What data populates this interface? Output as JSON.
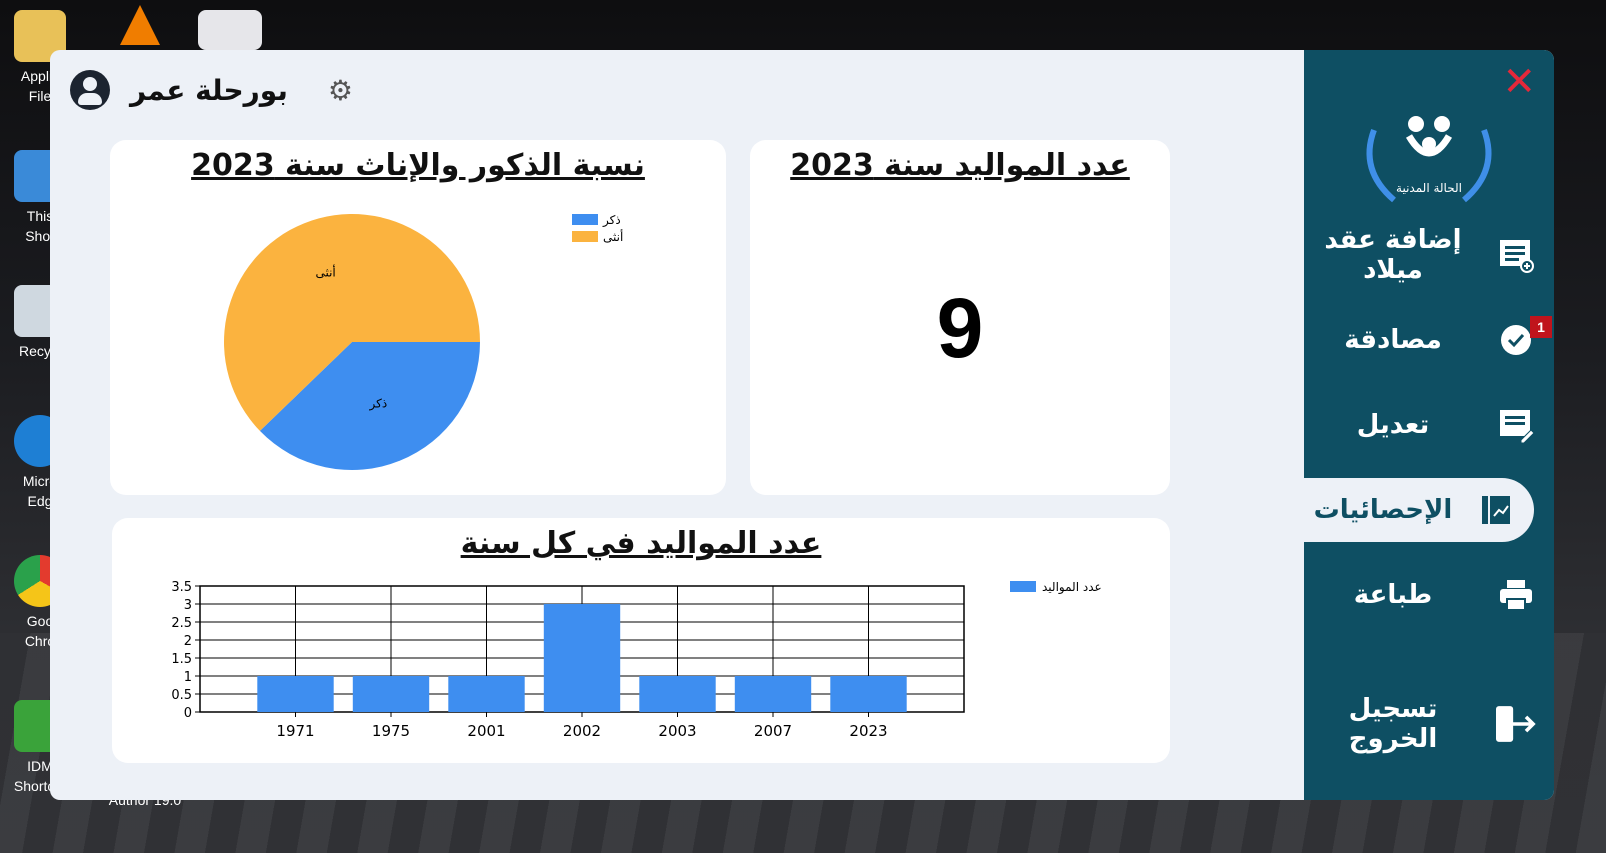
{
  "desktop": {
    "icons": [
      {
        "label": "Applic\nFile"
      },
      {
        "label": "This\nShor"
      },
      {
        "label": "Recycl"
      },
      {
        "label": "Micro\nEdg"
      },
      {
        "label": "Goo\nChro"
      },
      {
        "label": "IDM\nShortcut"
      },
      {
        "label": "Author 19.0"
      }
    ]
  },
  "header": {
    "user_name": "بورحلة عمر"
  },
  "cards": {
    "births_count": {
      "title": "عدد المواليد سنة 2023",
      "value": "9"
    },
    "gender_ratio": {
      "title": "نسبة الذكور والإناث سنة 2023"
    },
    "births_per_year": {
      "title": "عدد المواليد في كل سنة"
    }
  },
  "sidebar": {
    "logo_text": "الحالة المدنية",
    "items": [
      {
        "label": "إضافة عقد ميلاد",
        "icon": "add-document-icon"
      },
      {
        "label": "مصادقة",
        "icon": "verified-badge-icon",
        "badge": "1"
      },
      {
        "label": "تعديل",
        "icon": "edit-document-icon"
      },
      {
        "label": "الإحصائيات",
        "icon": "statistics-icon",
        "active": true
      },
      {
        "label": "طباعة",
        "icon": "printer-icon"
      },
      {
        "label": "تسجيل الخروج",
        "icon": "logout-icon"
      }
    ],
    "close_icon": "close-icon"
  },
  "colors": {
    "sidebar": "#0e4f63",
    "male": "#3e8ef0",
    "female": "#fbb33f",
    "close": "#e5283a",
    "badge": "#c0141c"
  },
  "chart_data": [
    {
      "type": "pie",
      "labels": [
        "ذكر",
        "أنثى"
      ],
      "values": [
        3.4,
        5.6
      ],
      "colors": [
        "#3e8ef0",
        "#fbb33f"
      ],
      "legend": [
        "ذكر",
        "أنثى"
      ],
      "legend_position": "top-right"
    },
    {
      "type": "bar",
      "categories": [
        "1971",
        "1975",
        "2001",
        "2002",
        "2003",
        "2007",
        "2023"
      ],
      "series": [
        {
          "name": "عدد المواليد",
          "values": [
            1,
            1,
            1,
            3,
            1,
            1,
            1
          ]
        }
      ],
      "yticks": [
        "0",
        "0.5",
        "1",
        "1.5",
        "2",
        "2.5",
        "3",
        "3.5"
      ],
      "ylim": [
        0,
        3.5
      ],
      "grid": true,
      "legend_position": "top-right",
      "color": "#3e8ef0"
    }
  ]
}
